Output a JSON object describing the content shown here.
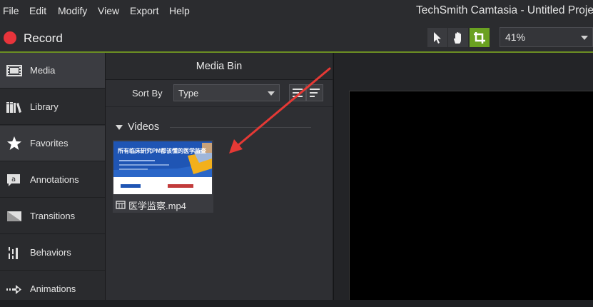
{
  "menu": [
    "File",
    "Edit",
    "Modify",
    "View",
    "Export",
    "Help"
  ],
  "app_title": "TechSmith Camtasia - Untitled Proje",
  "toolbar": {
    "record_label": "Record",
    "tools": [
      "pointer-icon",
      "hand-icon",
      "crop-icon"
    ],
    "zoom": "41%"
  },
  "sidebar": {
    "items": [
      {
        "label": "Media",
        "icon": "film-icon"
      },
      {
        "label": "Library",
        "icon": "books-icon"
      },
      {
        "label": "Favorites",
        "icon": "star-icon"
      },
      {
        "label": "Annotations",
        "icon": "speech-bubble-icon"
      },
      {
        "label": "Transitions",
        "icon": "transition-icon"
      },
      {
        "label": "Behaviors",
        "icon": "behaviors-icon"
      },
      {
        "label": "Animations",
        "icon": "animation-arrow-icon"
      }
    ],
    "active_index": 0
  },
  "media_bin": {
    "title": "Media Bin",
    "sort_label": "Sort By",
    "sort_value": "Type",
    "section_label": "Videos",
    "items": [
      {
        "name": "医学监察.mp4",
        "thumb_title": "所有临床研究PM都该懂的医学监查"
      }
    ]
  },
  "colors": {
    "accent_green": "#6aa121",
    "record_red": "#e8343b",
    "annotation_arrow": "#e53935"
  }
}
